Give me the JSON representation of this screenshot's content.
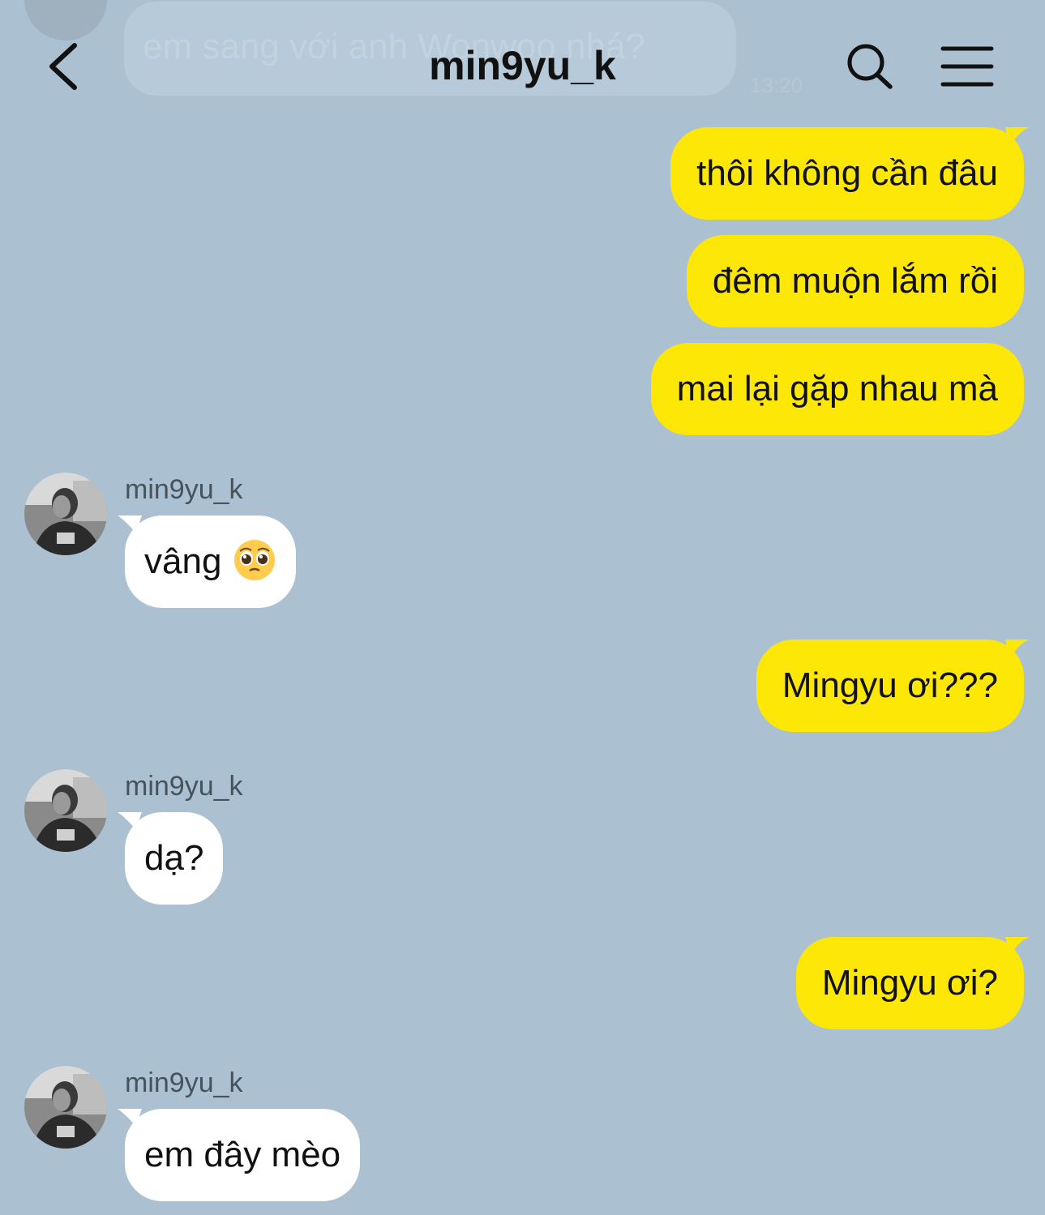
{
  "header": {
    "title": "min9yu_k",
    "back_icon": "chevron-left-icon",
    "search_icon": "search-icon",
    "menu_icon": "hamburger-menu-icon",
    "previous_message_text": "em sang với anh Wonwoo nhá?",
    "previous_message_time": "13:20"
  },
  "colors": {
    "background": "#abc1d1",
    "outgoing_bubble": "#fde706",
    "incoming_bubble": "#ffffff"
  },
  "messages": [
    {
      "direction": "out",
      "text": "thôi không cần đâu"
    },
    {
      "direction": "out",
      "text": "đêm muộn lắm rồi"
    },
    {
      "direction": "out",
      "text": "mai lại gặp nhau mà"
    },
    {
      "direction": "in",
      "sender": "min9yu_k",
      "text": "vâng",
      "emoji": "pleading-face-emoji"
    },
    {
      "direction": "out",
      "text": "Mingyu ơi???"
    },
    {
      "direction": "in",
      "sender": "min9yu_k",
      "text": "dạ?"
    },
    {
      "direction": "out",
      "text": "Mingyu ơi?"
    },
    {
      "direction": "in",
      "sender": "min9yu_k",
      "text": "em đây mèo"
    }
  ]
}
